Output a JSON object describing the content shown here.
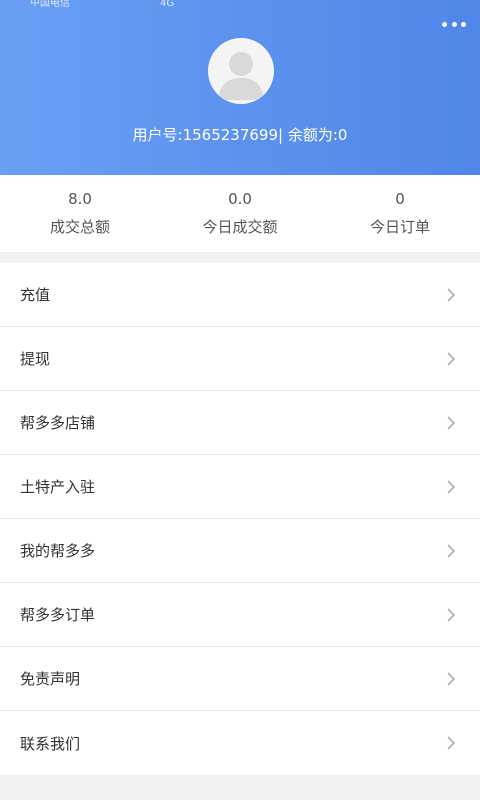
{
  "status_bar": {
    "carrier": "中国电信",
    "signal": "4G"
  },
  "header": {
    "user_line": "用户号:1565237699| 余额为:0"
  },
  "stats": [
    {
      "value": "8.0",
      "label": "成交总额"
    },
    {
      "value": "0.0",
      "label": "今日成交额"
    },
    {
      "value": "0",
      "label": "今日订单"
    }
  ],
  "menu": [
    {
      "label": "充值"
    },
    {
      "label": "提现"
    },
    {
      "label": "帮多多店铺"
    },
    {
      "label": "土特产入驻"
    },
    {
      "label": "我的帮多多"
    },
    {
      "label": "帮多多订单"
    },
    {
      "label": "免责声明"
    },
    {
      "label": "联系我们"
    }
  ]
}
